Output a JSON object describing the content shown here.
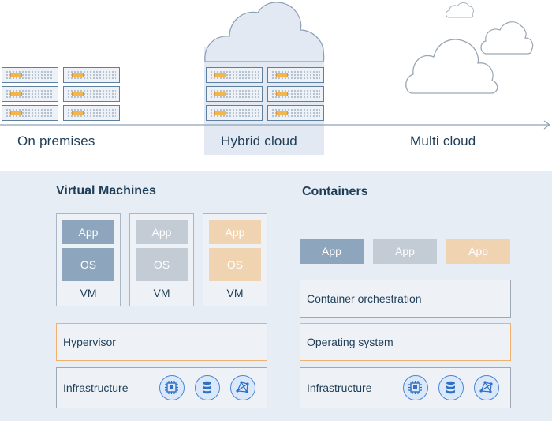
{
  "stages": {
    "on_premises": "On premises",
    "hybrid_cloud": "Hybrid cloud",
    "multi_cloud": "Multi cloud"
  },
  "virtual_machines": {
    "title": "Virtual Machines",
    "vms": [
      {
        "app": "App",
        "os": "OS",
        "label": "VM",
        "color": "blue"
      },
      {
        "app": "App",
        "os": "OS",
        "label": "VM",
        "color": "grey"
      },
      {
        "app": "App",
        "os": "OS",
        "label": "VM",
        "color": "peach"
      }
    ],
    "hypervisor": "Hypervisor",
    "infrastructure": "Infrastructure"
  },
  "containers": {
    "title": "Containers",
    "apps": [
      {
        "label": "App",
        "color": "blue"
      },
      {
        "label": "App",
        "color": "grey"
      },
      {
        "label": "App",
        "color": "peach"
      }
    ],
    "orchestration": "Container orchestration",
    "operating_system": "Operating system",
    "infrastructure": "Infrastructure"
  },
  "icons": [
    "cpu-icon",
    "database-icon",
    "network-icon"
  ],
  "colors": {
    "app_blue": "#8da6bd",
    "app_grey": "#c3cbd4",
    "app_peach": "#f0d4b2",
    "accent_orange": "#f0b070",
    "panel_bg": "#e7edf4",
    "icon_blue": "#4a86d6"
  }
}
